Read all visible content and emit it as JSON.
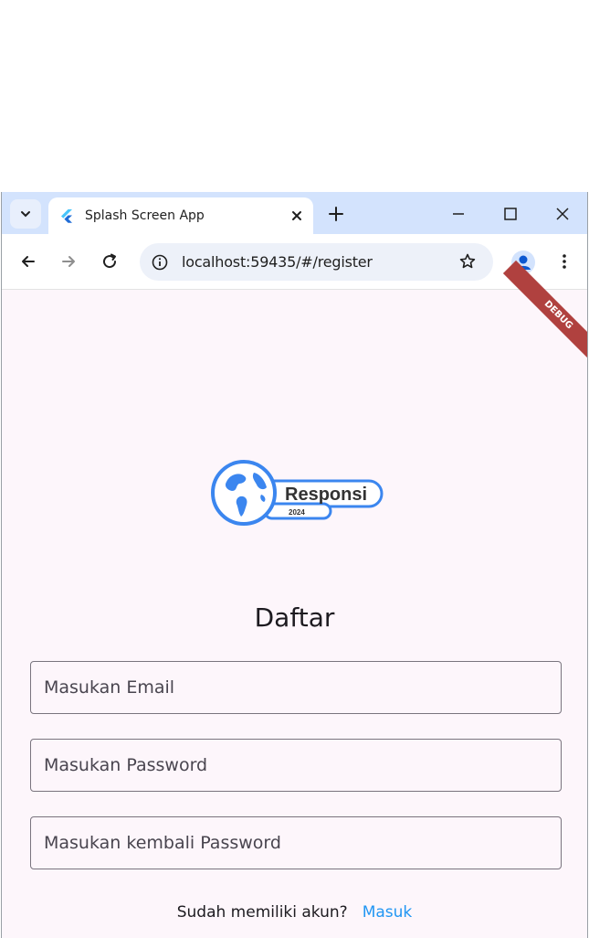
{
  "browser": {
    "tab_title": "Splash Screen App",
    "url": "localhost:59435/#/register",
    "accent_color": "#d3e3fd"
  },
  "app": {
    "debug_label": "DEBUG",
    "logo": {
      "brand_text": "Responsi",
      "year_text": "2024"
    },
    "heading": "Daftar",
    "fields": {
      "email_placeholder": "Masukan Email",
      "password_placeholder": "Masukan Password",
      "confirm_password_placeholder": "Masukan kembali Password"
    },
    "footer": {
      "question": "Sudah memiliki akun?",
      "login_link": "Masuk",
      "link_color": "#2196f3"
    }
  }
}
